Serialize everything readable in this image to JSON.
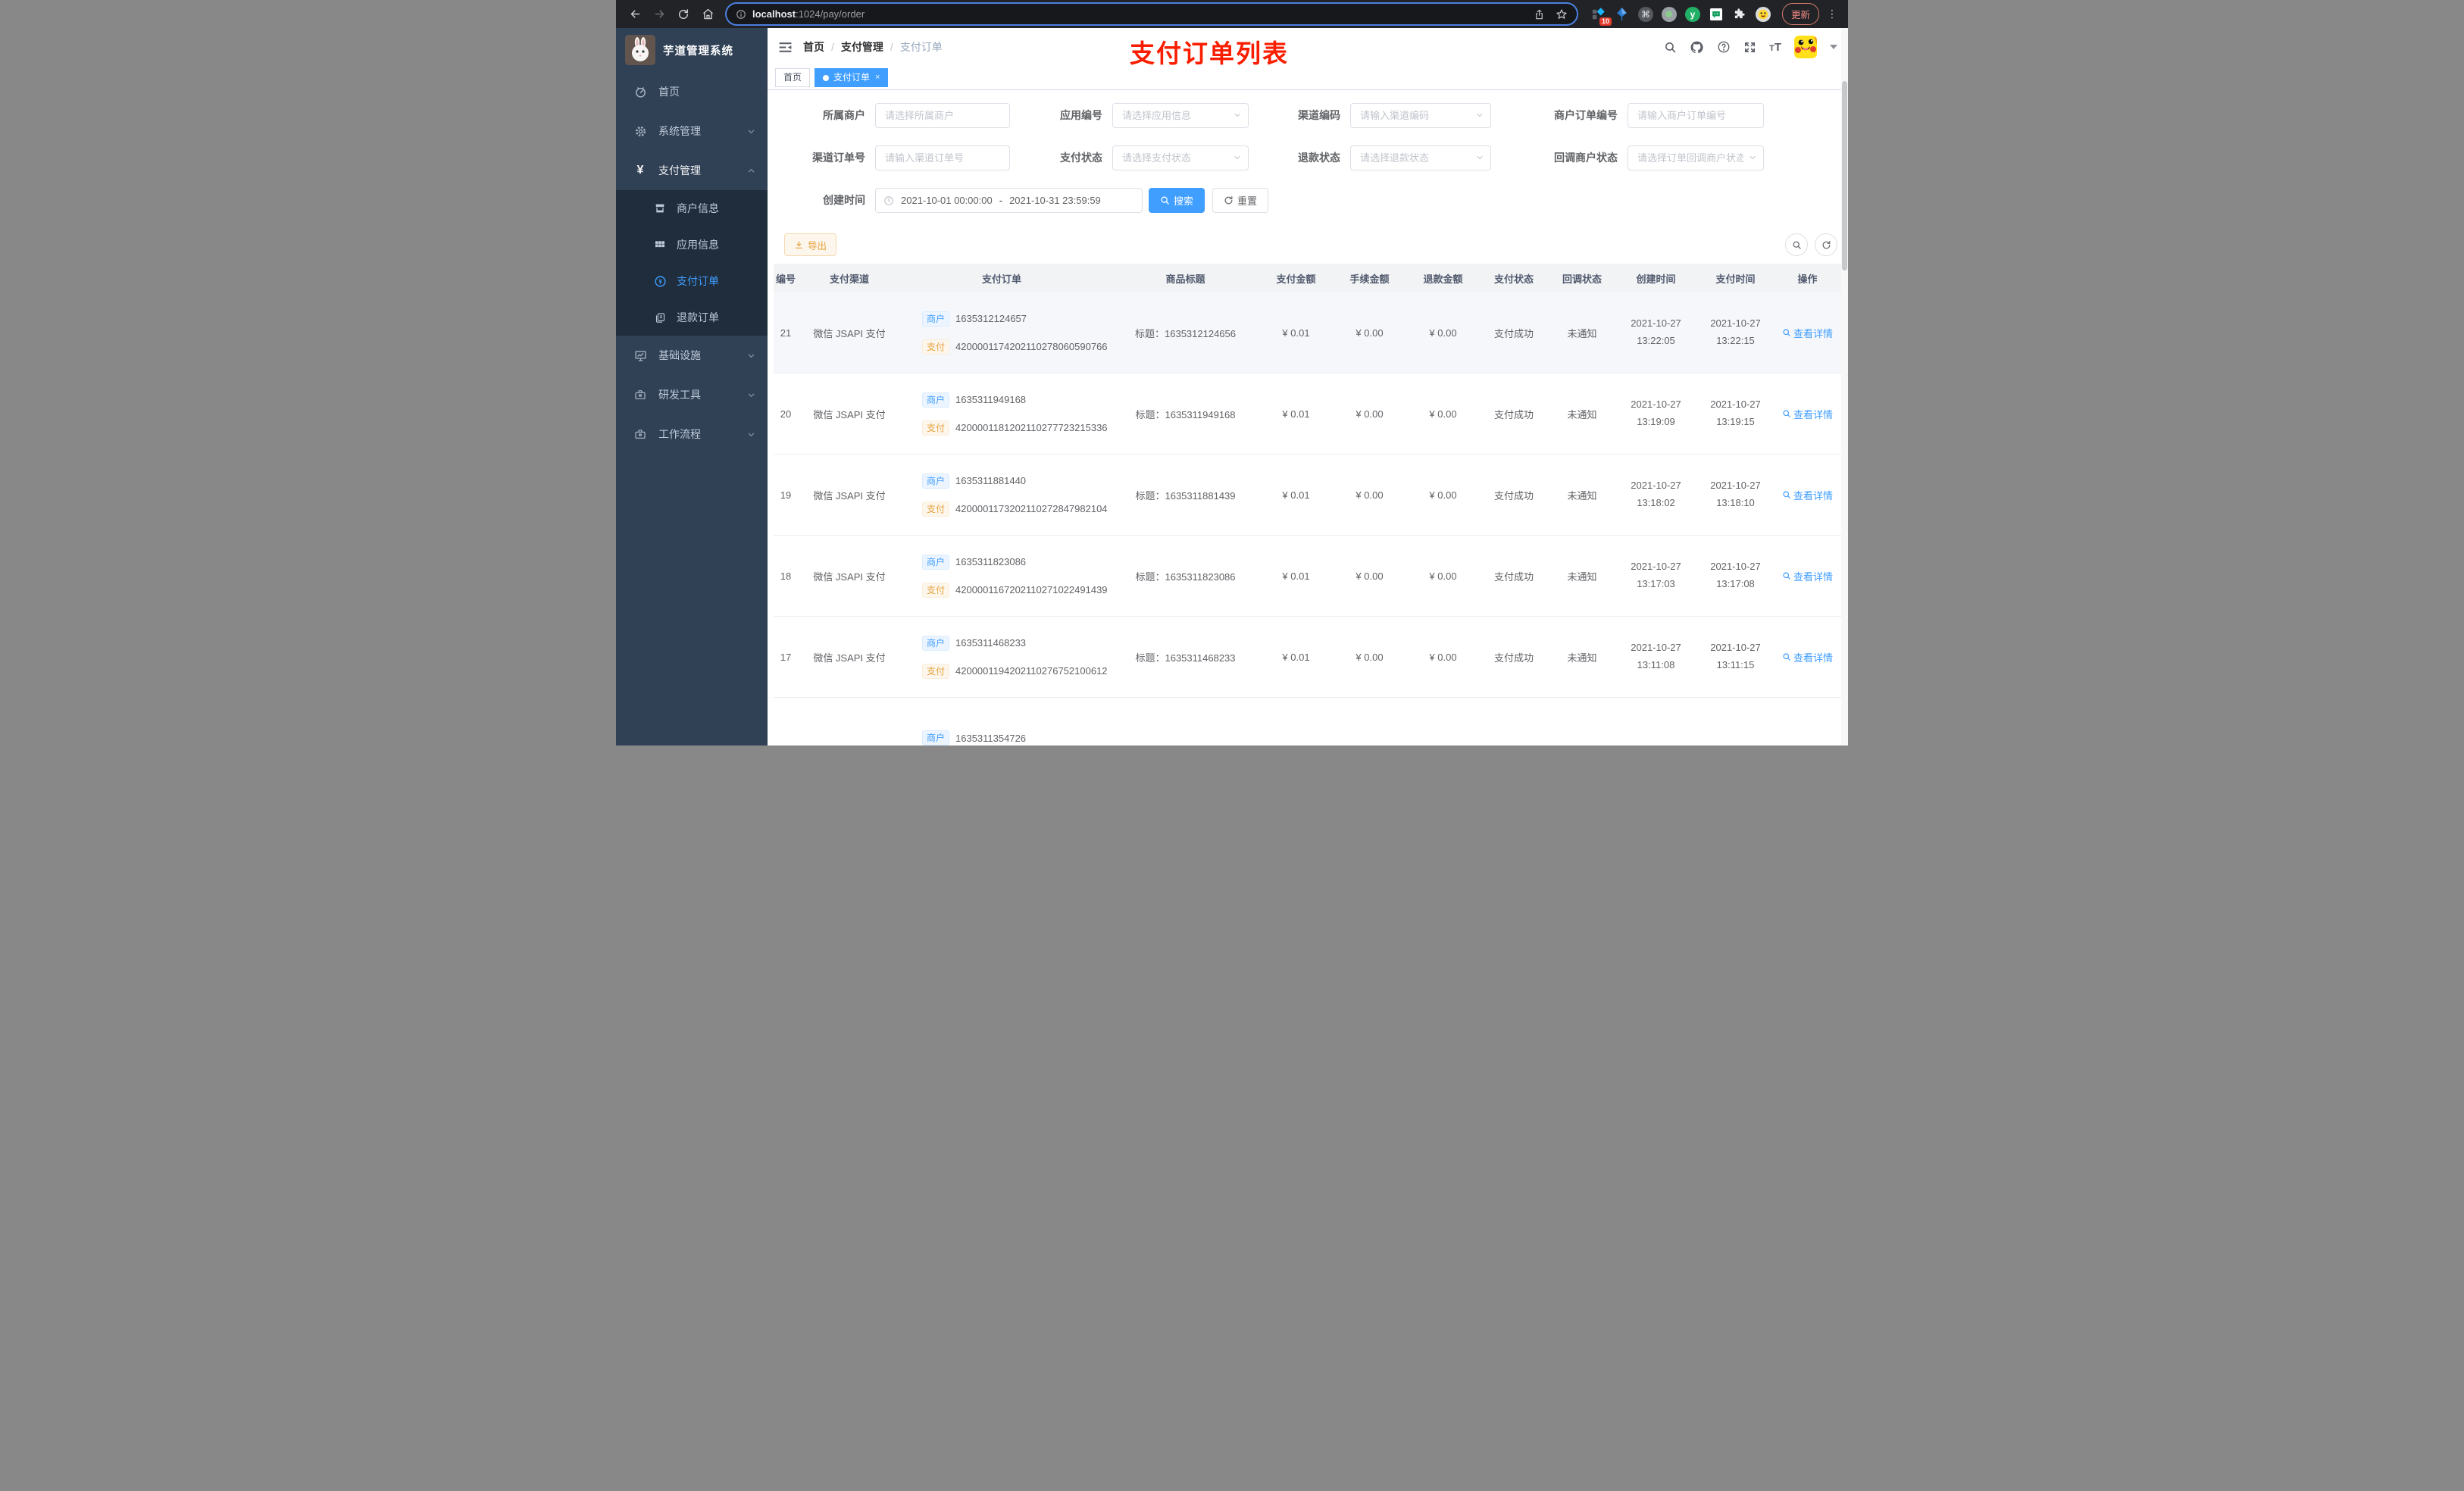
{
  "browser": {
    "url": {
      "host": "localhost",
      "rest": ":1024/pay/order"
    },
    "ext_badge": "10",
    "ext_y_label": "y",
    "update_label": "更新",
    "dots": "⋮"
  },
  "sidebar": {
    "title": "芋道管理系统",
    "menu": [
      {
        "label": "首页"
      },
      {
        "label": "系统管理"
      },
      {
        "label": "支付管理"
      },
      {
        "label": "基础设施"
      },
      {
        "label": "研发工具"
      },
      {
        "label": "工作流程"
      }
    ],
    "submenu": [
      {
        "label": "商户信息"
      },
      {
        "label": "应用信息"
      },
      {
        "label": "支付订单"
      },
      {
        "label": "退款订单"
      }
    ]
  },
  "navbar": {
    "breadcrumb": [
      "首页",
      "支付管理",
      "支付订单"
    ],
    "sep": "/",
    "annotation": "支付订单列表"
  },
  "tabs": [
    {
      "label": "首页"
    },
    {
      "label": "支付订单",
      "close": "×"
    }
  ],
  "filters": {
    "row1": [
      {
        "label": "所属商户",
        "placeholder": "请选择所属商户"
      },
      {
        "label": "应用编号",
        "placeholder": "请选择应用信息"
      },
      {
        "label": "渠道编码",
        "placeholder": "请输入渠道编码"
      },
      {
        "label": "商户订单编号",
        "placeholder": "请输入商户订单编号"
      }
    ],
    "row2": [
      {
        "label": "渠道订单号",
        "placeholder": "请输入渠道订单号"
      },
      {
        "label": "支付状态",
        "placeholder": "请选择支付状态"
      },
      {
        "label": "退款状态",
        "placeholder": "请选择退款状态"
      },
      {
        "label": "回调商户状态",
        "placeholder": "请选择订单回调商户状态"
      }
    ],
    "created": {
      "label": "创建时间",
      "start": "2021-10-01 00:00:00",
      "separator": "-",
      "end": "2021-10-31 23:59:59"
    },
    "search_label": "搜索",
    "reset_label": "重置"
  },
  "toolbar": {
    "export_label": "导出"
  },
  "table": {
    "headers": [
      "编号",
      "支付渠道",
      "支付订单",
      "商品标题",
      "支付金额",
      "手续金额",
      "退款金额",
      "支付状态",
      "回调状态",
      "创建时间",
      "支付时间",
      "操作"
    ],
    "merchant_tag": "商户",
    "pay_tag": "支付",
    "action_label": "查看详情",
    "rows": [
      {
        "id": "21",
        "channel": "微信 JSAPI 支付",
        "merchant_no": "1635312124657",
        "pay_no": "4200001174202110278060590766",
        "title": "标题：1635312124656",
        "amount": "¥ 0.01",
        "fee": "¥ 0.00",
        "refund": "¥ 0.00",
        "status": "支付成功",
        "notify": "未通知",
        "created_date": "2021-10-27",
        "created_time": "13:22:05",
        "paid_date": "2021-10-27",
        "paid_time": "13:22:15"
      },
      {
        "id": "20",
        "channel": "微信 JSAPI 支付",
        "merchant_no": "1635311949168",
        "pay_no": "4200001181202110277723215336",
        "title": "标题：1635311949168",
        "amount": "¥ 0.01",
        "fee": "¥ 0.00",
        "refund": "¥ 0.00",
        "status": "支付成功",
        "notify": "未通知",
        "created_date": "2021-10-27",
        "created_time": "13:19:09",
        "paid_date": "2021-10-27",
        "paid_time": "13:19:15"
      },
      {
        "id": "19",
        "channel": "微信 JSAPI 支付",
        "merchant_no": "1635311881440",
        "pay_no": "4200001173202110272847982104",
        "title": "标题：1635311881439",
        "amount": "¥ 0.01",
        "fee": "¥ 0.00",
        "refund": "¥ 0.00",
        "status": "支付成功",
        "notify": "未通知",
        "created_date": "2021-10-27",
        "created_time": "13:18:02",
        "paid_date": "2021-10-27",
        "paid_time": "13:18:10"
      },
      {
        "id": "18",
        "channel": "微信 JSAPI 支付",
        "merchant_no": "1635311823086",
        "pay_no": "4200001167202110271022491439",
        "title": "标题：1635311823086",
        "amount": "¥ 0.01",
        "fee": "¥ 0.00",
        "refund": "¥ 0.00",
        "status": "支付成功",
        "notify": "未通知",
        "created_date": "2021-10-27",
        "created_time": "13:17:03",
        "paid_date": "2021-10-27",
        "paid_time": "13:17:08"
      },
      {
        "id": "17",
        "channel": "微信 JSAPI 支付",
        "merchant_no": "1635311468233",
        "pay_no": "4200001194202110276752100612",
        "title": "标题：1635311468233",
        "amount": "¥ 0.01",
        "fee": "¥ 0.00",
        "refund": "¥ 0.00",
        "status": "支付成功",
        "notify": "未通知",
        "created_date": "2021-10-27",
        "created_time": "13:11:08",
        "paid_date": "2021-10-27",
        "paid_time": "13:11:15"
      },
      {
        "id": "",
        "channel": "",
        "merchant_no": "1635311354726"
      }
    ]
  }
}
